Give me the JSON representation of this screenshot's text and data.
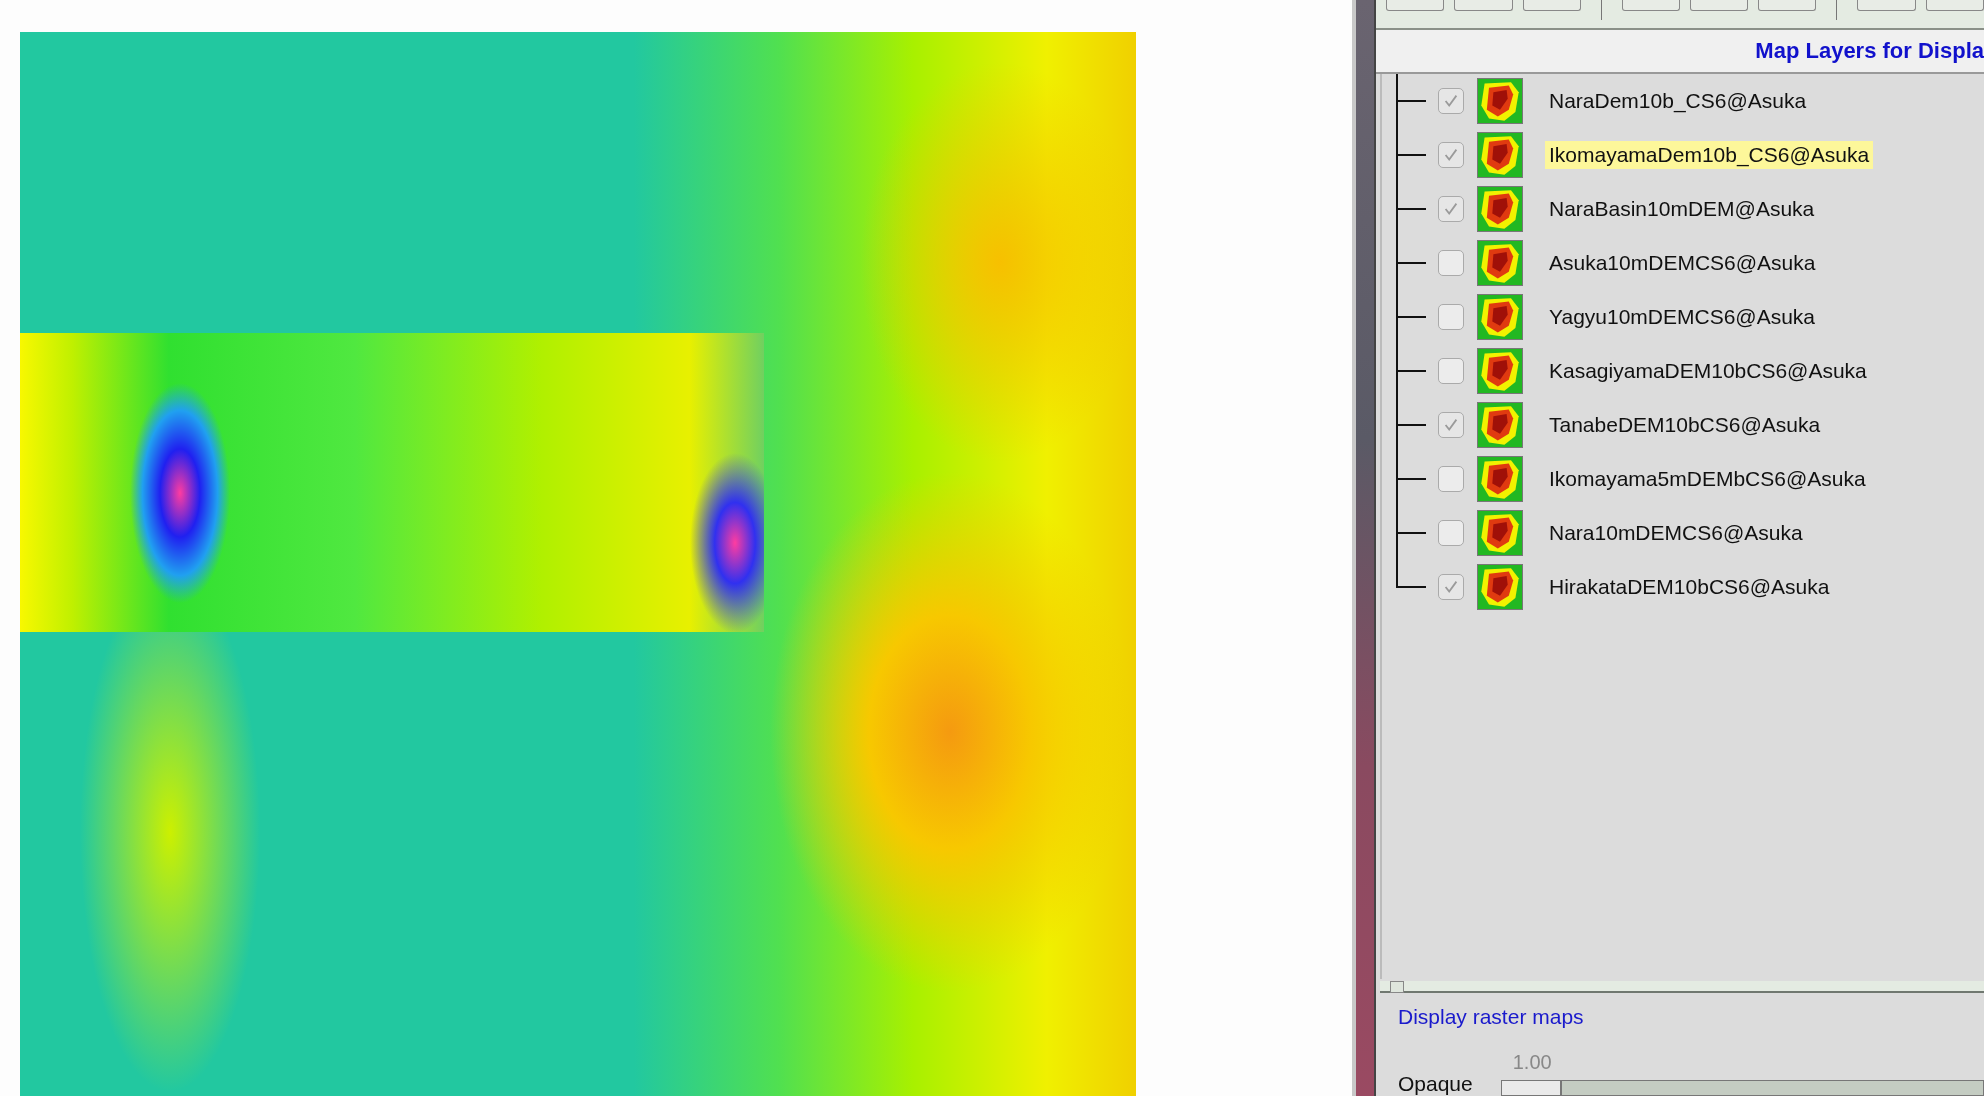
{
  "layer_panel": {
    "title": "Map Layers for Displa",
    "layers": [
      {
        "name": "NaraDem10b_CS6@Asuka",
        "checked": true,
        "selected": false
      },
      {
        "name": "IkomayamaDem10b_CS6@Asuka",
        "checked": true,
        "selected": true
      },
      {
        "name": "NaraBasin10mDEM@Asuka",
        "checked": true,
        "selected": false
      },
      {
        "name": "Asuka10mDEMCS6@Asuka",
        "checked": false,
        "selected": false
      },
      {
        "name": "Yagyu10mDEMCS6@Asuka",
        "checked": false,
        "selected": false
      },
      {
        "name": "KasagiyamaDEM10bCS6@Asuka",
        "checked": false,
        "selected": false
      },
      {
        "name": "TanabeDEM10bCS6@Asuka",
        "checked": true,
        "selected": false
      },
      {
        "name": "Ikomayama5mDEMbCS6@Asuka",
        "checked": false,
        "selected": false
      },
      {
        "name": "Nara10mDEMCS6@Asuka",
        "checked": false,
        "selected": false
      },
      {
        "name": "HirakataDEM10bCS6@Asuka",
        "checked": true,
        "selected": false
      }
    ],
    "status": "Display raster maps",
    "opacity": {
      "label": "Opaque",
      "reading": "1.00",
      "level": 0
    }
  }
}
